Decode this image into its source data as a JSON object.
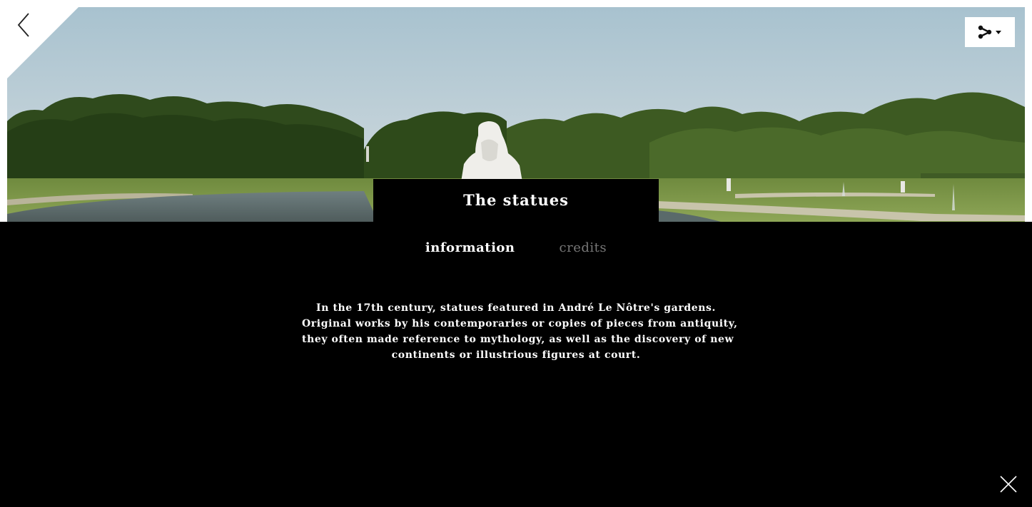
{
  "panel": {
    "title": "The statues",
    "tabs": [
      {
        "label": "information",
        "active": true
      },
      {
        "label": "credits",
        "active": false
      }
    ],
    "description": [
      "In the 17th century, statues featured in André Le Nôtre's gardens.",
      "Original works by his contemporaries or copies of pieces from antiquity,",
      "they often made reference to mythology, as well as the discovery of new",
      "continents or illustrious figures at court."
    ]
  },
  "icons": {
    "back": "chevron-left-icon",
    "share": "share-icon",
    "dropdown": "caret-down-icon",
    "close": "close-icon"
  },
  "colors": {
    "panel_background": "#000000",
    "active_tab": "#ffffff",
    "inactive_tab": "#777777"
  }
}
